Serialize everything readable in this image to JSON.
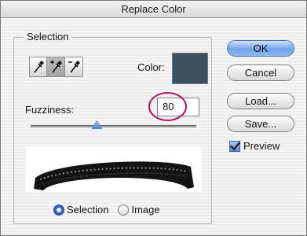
{
  "window": {
    "title": "Replace Color"
  },
  "selection_group": {
    "legend": "Selection",
    "eyedroppers": [
      {
        "name": "eyedropper-icon",
        "active": false
      },
      {
        "name": "eyedropper-plus-icon",
        "active": true
      },
      {
        "name": "eyedropper-minus-icon",
        "active": false
      }
    ],
    "color_label": "Color:",
    "color_swatch": "#3a4f62",
    "fuzziness": {
      "label": "Fuzziness:",
      "value": "80",
      "slider_fraction": 0.4
    },
    "view_options": [
      {
        "label": "Selection",
        "checked": true
      },
      {
        "label": "Image",
        "checked": false
      }
    ]
  },
  "buttons": {
    "ok": "OK",
    "cancel": "Cancel",
    "load": "Load...",
    "save": "Save..."
  },
  "preview": {
    "label": "Preview",
    "checked": true
  },
  "colors": {
    "accent": "#6fa3e8",
    "callout": "#b0125d"
  }
}
